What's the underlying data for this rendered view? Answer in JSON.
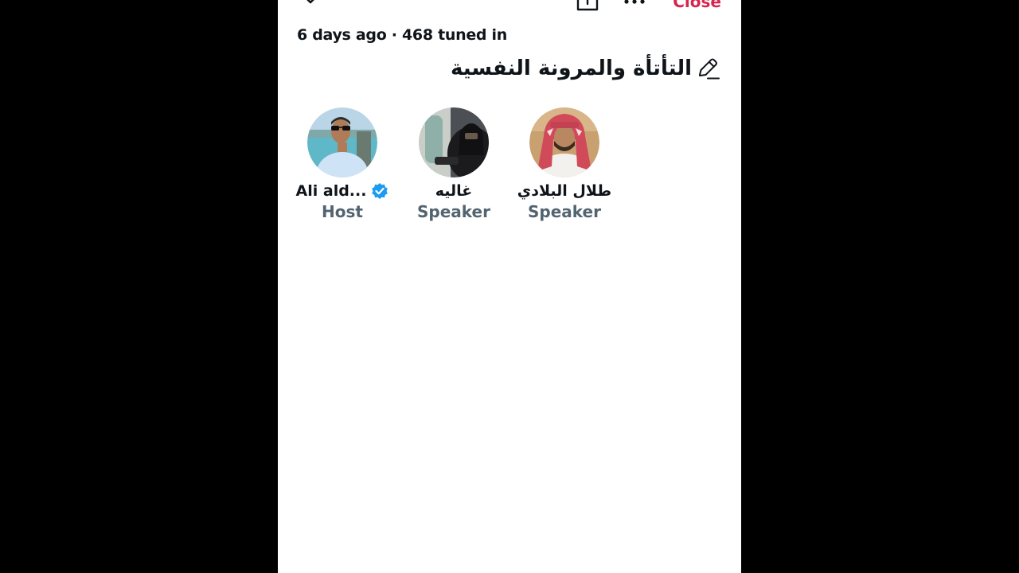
{
  "header": {
    "close_label": "Close",
    "icons": [
      "chevron-down-icon",
      "share-icon",
      "more-icon"
    ]
  },
  "space": {
    "meta": "6 days ago · 468 tuned in",
    "title": "التأتأة والمرونة النفسية"
  },
  "participants": [
    {
      "name": "Ali ald...",
      "role": "Host",
      "verified": true
    },
    {
      "name": "غاليه",
      "role": "Speaker",
      "verified": false
    },
    {
      "name": "طلال البلادي",
      "role": "Speaker",
      "verified": false
    }
  ],
  "colors": {
    "close": "#d6244d",
    "role_text": "#536471",
    "verified_badge": "#1d9bf0",
    "primary_text": "#0f1419"
  }
}
